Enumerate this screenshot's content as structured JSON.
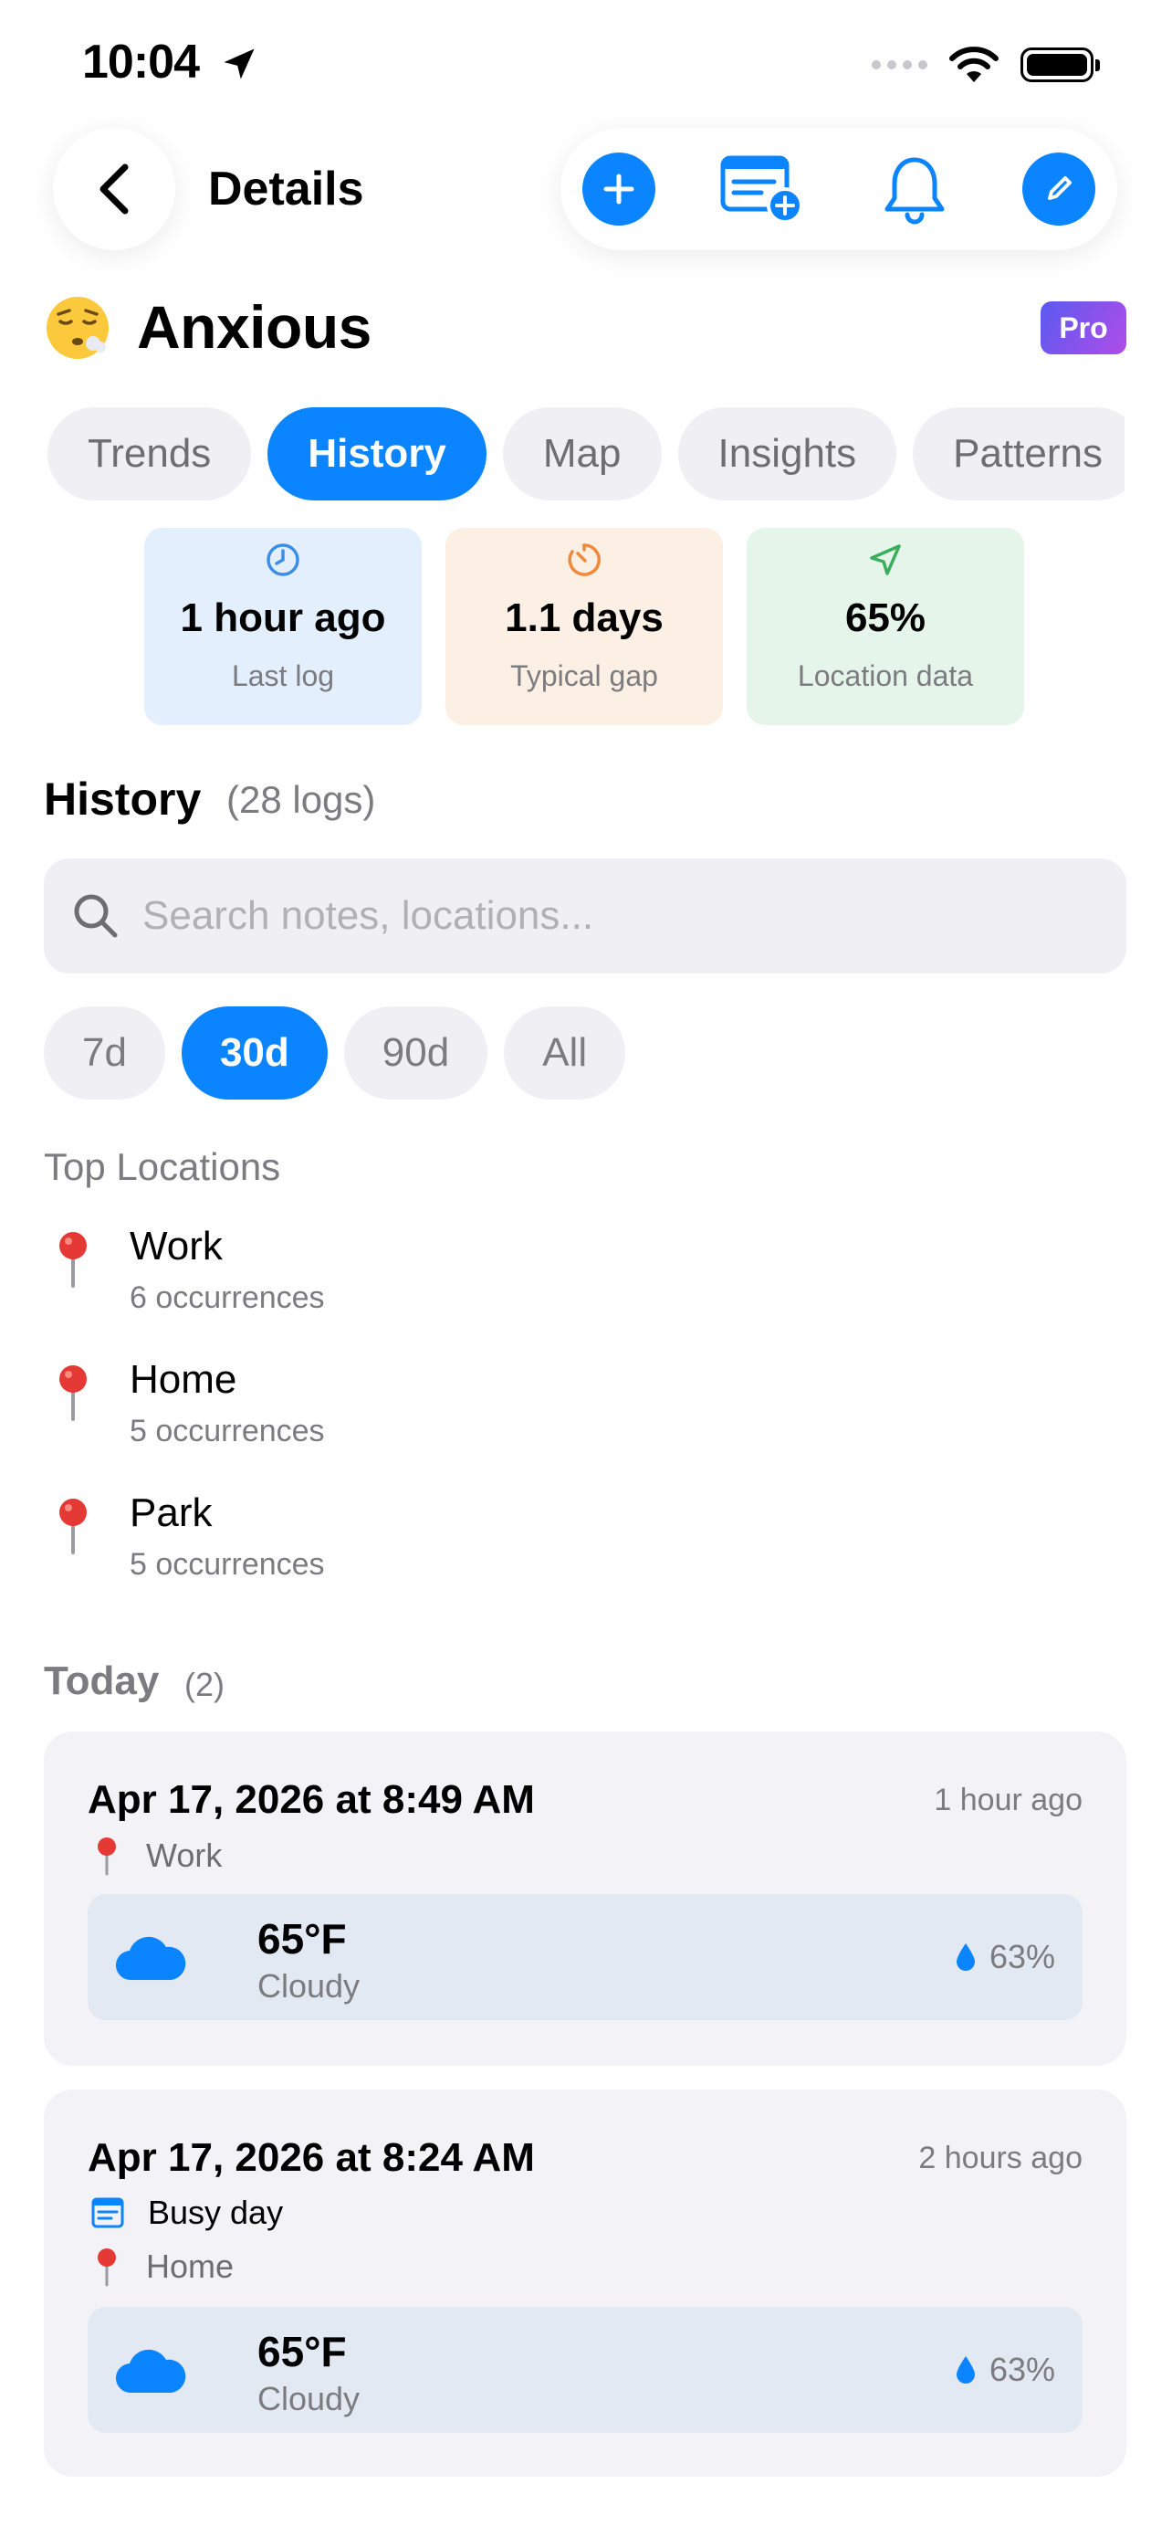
{
  "status_bar": {
    "time": "10:04"
  },
  "nav": {
    "title": "Details"
  },
  "header": {
    "mood": "Anxious",
    "badge": "Pro"
  },
  "tabs": [
    {
      "label": "Trends",
      "active": false
    },
    {
      "label": "History",
      "active": true
    },
    {
      "label": "Map",
      "active": false
    },
    {
      "label": "Insights",
      "active": false
    },
    {
      "label": "Patterns",
      "active": false
    }
  ],
  "stats": [
    {
      "value": "1 hour ago",
      "label": "Last log",
      "bg": "#e3effc",
      "icon_color": "#3b8ee8",
      "icon": "clock-icon"
    },
    {
      "value": "1.1 days",
      "label": "Typical gap",
      "bg": "#fcefe3",
      "icon_color": "#f0893a",
      "icon": "timer-icon"
    },
    {
      "value": "65%",
      "label": "Location data",
      "bg": "#e6f5ea",
      "icon_color": "#3aae5c",
      "icon": "location-arrow-icon"
    }
  ],
  "history": {
    "title": "History",
    "count": "(28 logs)",
    "search_placeholder": "Search notes, locations...",
    "ranges": [
      {
        "label": "7d",
        "active": false
      },
      {
        "label": "30d",
        "active": true
      },
      {
        "label": "90d",
        "active": false
      },
      {
        "label": "All",
        "active": false
      }
    ]
  },
  "top_locations": {
    "title": "Top Locations",
    "items": [
      {
        "name": "Work",
        "count": "6 occurrences"
      },
      {
        "name": "Home",
        "count": "5 occurrences"
      },
      {
        "name": "Park",
        "count": "5 occurrences"
      }
    ]
  },
  "today": {
    "label": "Today",
    "count": "(2)",
    "entries": [
      {
        "date": "Apr 17, 2026 at 8:49 AM",
        "ago": "1 hour ago",
        "note": null,
        "location": "Work",
        "temp": "65°F",
        "condition": "Cloudy",
        "humidity": "63%"
      },
      {
        "date": "Apr 17, 2026 at 8:24 AM",
        "ago": "2 hours ago",
        "note": "Busy day",
        "location": "Home",
        "temp": "65°F",
        "condition": "Cloudy",
        "humidity": "63%"
      }
    ]
  },
  "colors": {
    "accent": "#0a84ff",
    "secondary_text": "#7b7b80"
  }
}
